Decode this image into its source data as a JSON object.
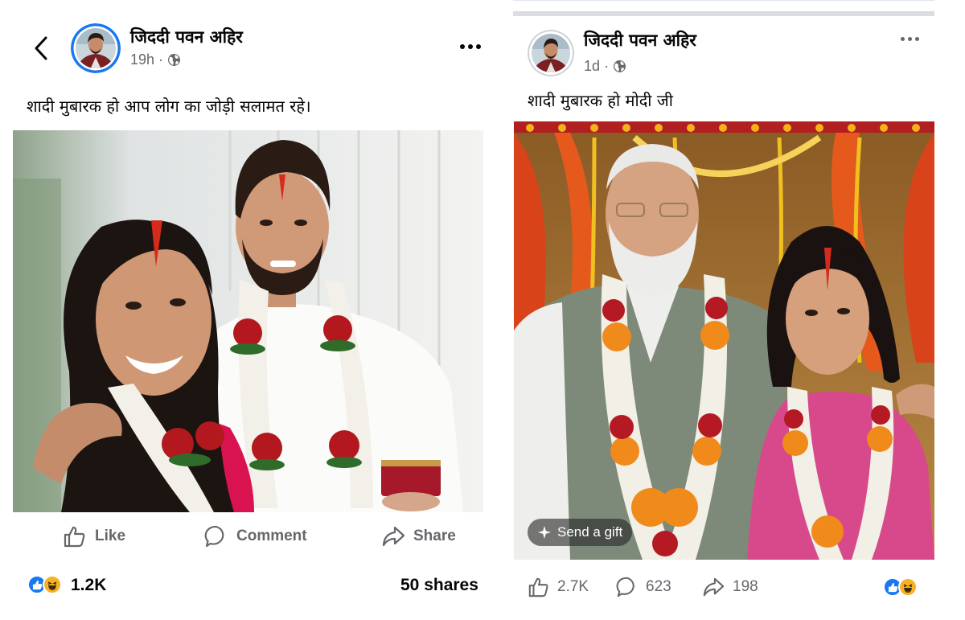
{
  "posts": [
    {
      "author": "जिददी पवन अहिर",
      "time": "19h",
      "audience_icon": "globe-icon",
      "text": "शादी मुबारक हो आप लोग का जोड़ी सलामत रहे।",
      "photo_description": "Couple in wedding garlands of white flowers and red roses, groom in white kurta holding a small red gift box, bride in pink saree with sindoor",
      "actions": {
        "like": "Like",
        "comment": "Comment",
        "share": "Share"
      },
      "reactions": [
        "like",
        "haha"
      ],
      "reaction_total": "1.2K",
      "shares": "50 shares"
    },
    {
      "author": "जिददी पवन अहिर",
      "time": "1d",
      "audience_icon": "globe-icon",
      "text": "शादी मुबारक हो मोदी जी",
      "photo_description": "Older man with white beard in grey vest and marigold garland standing beside young woman in pink saree with garland, in front of decorated floral wedding mandap",
      "send_gift": "Send a gift",
      "likes": "2.7K",
      "comments": "623",
      "shares": "198",
      "reactions": [
        "like",
        "haha"
      ]
    }
  ],
  "colors": {
    "facebook_blue": "#1877f2",
    "text_primary": "#050505",
    "text_secondary": "#65676b",
    "divider": "#dadde1",
    "haha_yellow": "#f7b125"
  }
}
